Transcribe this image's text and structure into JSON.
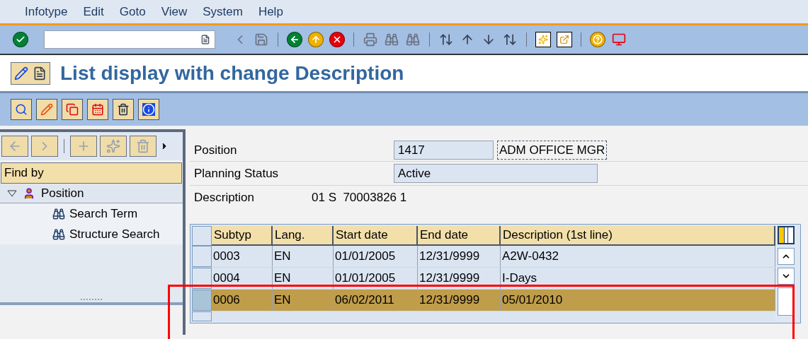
{
  "menu": [
    {
      "label": "Infotype"
    },
    {
      "label": "Edit"
    },
    {
      "label": "Goto"
    },
    {
      "label": "View"
    },
    {
      "label": "System"
    },
    {
      "label": "Help"
    }
  ],
  "title": "List display with change Description",
  "left_panel": {
    "find_by": "Find by",
    "tree": [
      {
        "label": "Position",
        "expanded": true,
        "children": [
          {
            "label": "Search Term"
          },
          {
            "label": "Structure Search"
          }
        ]
      }
    ]
  },
  "form": {
    "position": {
      "label": "Position",
      "number": "1417",
      "text": "ADM OFFICE MGR"
    },
    "planning_status": {
      "label": "Planning Status",
      "value": "Active"
    },
    "description": {
      "label": "Description",
      "value": "01 S  70003826 1"
    }
  },
  "table": {
    "columns": [
      "Subtyp",
      "Lang.",
      "Start date",
      "End date",
      "Description (1st line)"
    ],
    "rows": [
      {
        "cells": [
          "0003",
          "EN",
          "01/01/2005",
          "12/31/9999",
          "A2W-0432"
        ],
        "selected": false
      },
      {
        "cells": [
          "0004",
          "EN",
          "01/01/2005",
          "12/31/9999",
          "I-Days"
        ],
        "selected": false
      },
      {
        "cells": [
          "0006",
          "EN",
          "06/02/2011",
          "12/31/9999",
          "05/01/2010"
        ],
        "selected": true
      }
    ]
  }
}
